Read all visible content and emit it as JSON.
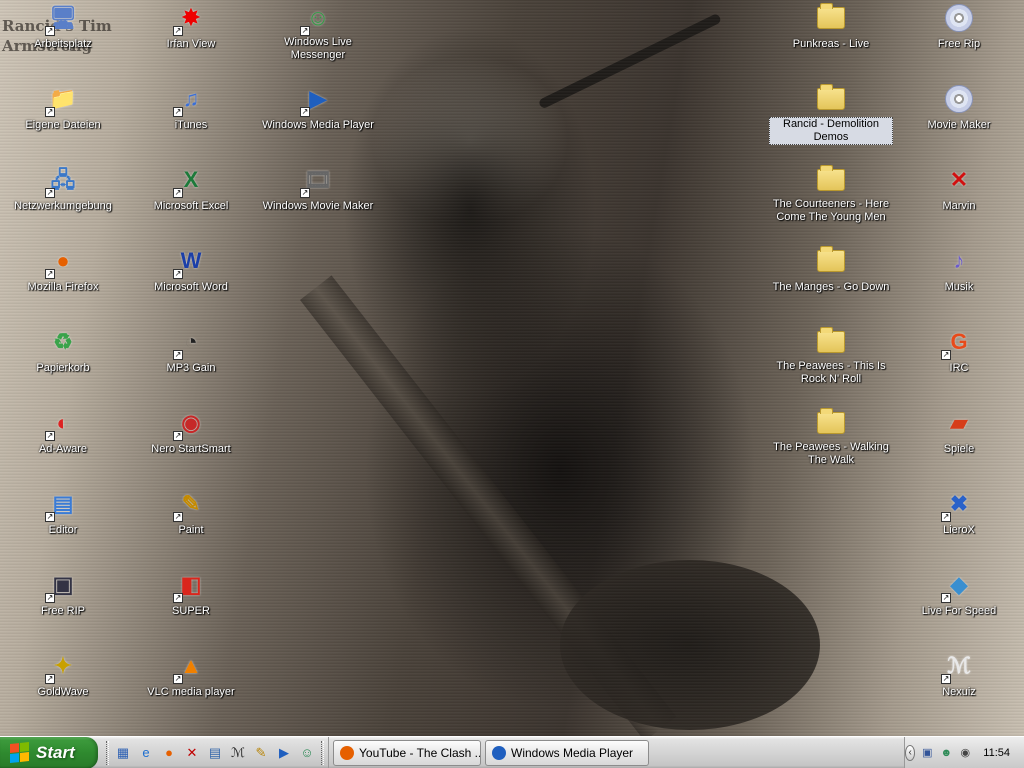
{
  "desktop": {
    "left_icons": [
      {
        "id": "arbeitsplatz",
        "label": "Arbeitsplatz",
        "icon": "computer-icon",
        "shortcut": true
      },
      {
        "id": "eigene-dateien",
        "label": "Eigene Dateien",
        "icon": "documents-folder-icon",
        "shortcut": true
      },
      {
        "id": "netzwerkumgebung",
        "label": "Netzwerkumgebung",
        "icon": "network-icon",
        "shortcut": true
      },
      {
        "id": "mozilla-firefox",
        "label": "Mozilla Firefox",
        "icon": "firefox-icon",
        "shortcut": true
      },
      {
        "id": "papierkorb",
        "label": "Papierkorb",
        "icon": "recycle-bin-icon",
        "shortcut": false
      },
      {
        "id": "ad-aware",
        "label": "Ad-Aware",
        "icon": "adaware-icon",
        "shortcut": true
      },
      {
        "id": "editor",
        "label": "Editor",
        "icon": "notepad-icon",
        "shortcut": true
      },
      {
        "id": "free-rip-left",
        "label": "Free RIP",
        "icon": "cd-ripper-icon",
        "shortcut": true
      },
      {
        "id": "goldwave",
        "label": "GoldWave",
        "icon": "goldwave-icon",
        "shortcut": true
      }
    ],
    "mid1_icons": [
      {
        "id": "irfan-view",
        "label": "Irfan View",
        "icon": "irfanview-icon",
        "shortcut": true
      },
      {
        "id": "itunes",
        "label": "iTunes",
        "icon": "itunes-icon",
        "shortcut": true
      },
      {
        "id": "microsoft-excel",
        "label": "Microsoft Excel",
        "icon": "excel-icon",
        "shortcut": true
      },
      {
        "id": "microsoft-word",
        "label": "Microsoft Word",
        "icon": "word-icon",
        "shortcut": true
      },
      {
        "id": "mp3-gain",
        "label": "MP3 Gain",
        "icon": "mp3gain-icon",
        "shortcut": true
      },
      {
        "id": "nero-startsmart",
        "label": "Nero StartSmart",
        "icon": "nero-icon",
        "shortcut": true
      },
      {
        "id": "paint",
        "label": "Paint",
        "icon": "paint-icon",
        "shortcut": true
      },
      {
        "id": "super",
        "label": "SUPER",
        "icon": "super-icon",
        "shortcut": true
      },
      {
        "id": "vlc",
        "label": "VLC media player",
        "icon": "vlc-icon",
        "shortcut": true
      }
    ],
    "mid2_icons": [
      {
        "id": "wlm",
        "label": "Windows Live Messenger",
        "icon": "messenger-icon",
        "shortcut": true
      },
      {
        "id": "wmp",
        "label": "Windows Media Player",
        "icon": "media-player-icon",
        "shortcut": true
      },
      {
        "id": "wmm",
        "label": "Windows Movie Maker",
        "icon": "movie-maker-icon",
        "shortcut": true
      }
    ],
    "right1_icons": [
      {
        "id": "punkreas",
        "label": "Punkreas - Live",
        "icon": "folder-icon",
        "shortcut": false,
        "selected": false
      },
      {
        "id": "rancid",
        "label": "Rancid - Demolition Demos",
        "icon": "folder-icon",
        "shortcut": false,
        "selected": true
      },
      {
        "id": "courteeners",
        "label": "The Courteeners - Here Come The Young Men",
        "icon": "folder-icon",
        "shortcut": false,
        "selected": false
      },
      {
        "id": "manges",
        "label": "The Manges - Go Down",
        "icon": "folder-icon",
        "shortcut": false,
        "selected": false
      },
      {
        "id": "peawees-rocknroll",
        "label": "The Peawees - This Is Rock N' Roll",
        "icon": "folder-icon",
        "shortcut": false,
        "selected": false
      },
      {
        "id": "peawees-walk",
        "label": "The Peawees - Walking The Walk",
        "icon": "folder-icon",
        "shortcut": false,
        "selected": false
      }
    ],
    "right2_icons": [
      {
        "id": "free-rip-right",
        "label": "Free Rip",
        "icon": "cd-disc-icon",
        "shortcut": false
      },
      {
        "id": "movie-maker",
        "label": "Movie Maker",
        "icon": "movie-maker-disc-icon",
        "shortcut": false
      },
      {
        "id": "marvin",
        "label": "Marvin",
        "icon": "red-x-icon",
        "shortcut": false
      },
      {
        "id": "musik",
        "label": "Musik",
        "icon": "music-file-icon",
        "shortcut": false
      },
      {
        "id": "irc",
        "label": "IRC",
        "icon": "irc-icon",
        "shortcut": true
      },
      {
        "id": "spiele",
        "label": "Spiele",
        "icon": "games-icon",
        "shortcut": false
      },
      {
        "id": "lierox",
        "label": "LieroX",
        "icon": "lierox-icon",
        "shortcut": true
      },
      {
        "id": "live-for-speed",
        "label": "Live For Speed",
        "icon": "lfs-icon",
        "shortcut": true
      },
      {
        "id": "nexuiz",
        "label": "Nexuiz",
        "icon": "nexuiz-icon",
        "shortcut": true
      }
    ],
    "wallpaper_text": "Rancid's Tim Armstrong"
  },
  "taskbar": {
    "start_label": "Start",
    "quicklaunch": [
      {
        "name": "show-desktop-icon",
        "glyph": "▦",
        "color": "#2b5fb3"
      },
      {
        "name": "internet-explorer-icon",
        "glyph": "e",
        "color": "#1e6fd0"
      },
      {
        "name": "firefox-quick-icon",
        "glyph": "●",
        "color": "#e66000"
      },
      {
        "name": "marvin-quick-icon",
        "glyph": "✕",
        "color": "#c00000"
      },
      {
        "name": "notepad-quick-icon",
        "glyph": "▤",
        "color": "#3366aa"
      },
      {
        "name": "nexuiz-quick-icon",
        "glyph": "ℳ",
        "color": "#222222"
      },
      {
        "name": "paint-quick-icon",
        "glyph": "✎",
        "color": "#b8860b"
      },
      {
        "name": "media-player-quick-icon",
        "glyph": "▶",
        "color": "#1f5fbf"
      },
      {
        "name": "messenger-quick-icon",
        "glyph": "☺",
        "color": "#2e8b57"
      }
    ],
    "tasks": [
      {
        "label": "YouTube - The Clash ...",
        "icon": "firefox-icon",
        "color": "#e66000"
      },
      {
        "label": "Windows Media Player",
        "icon": "media-player-icon",
        "color": "#1f5fbf"
      }
    ],
    "tray": {
      "arrow": "‹",
      "icons": [
        {
          "name": "network-tray-icon",
          "glyph": "▣",
          "color": "#335599"
        },
        {
          "name": "messenger-tray-icon",
          "glyph": "☻",
          "color": "#2e8b57"
        },
        {
          "name": "volume-tray-icon",
          "glyph": "◉",
          "color": "#444444"
        }
      ],
      "clock": "11:54"
    }
  }
}
